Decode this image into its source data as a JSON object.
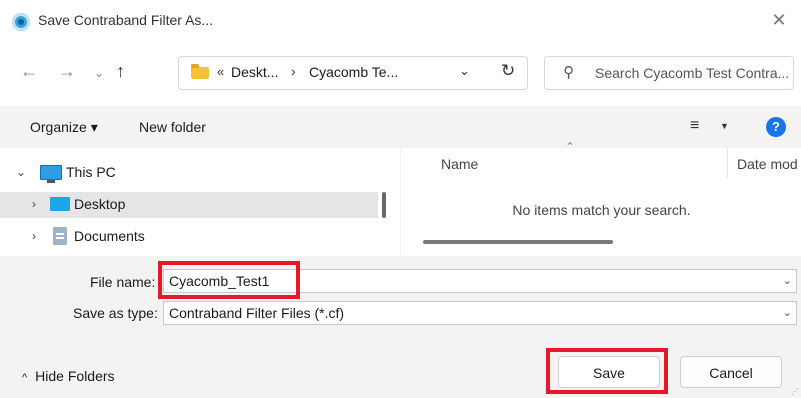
{
  "window": {
    "title": "Save Contraband Filter As...",
    "close_glyph": "✕"
  },
  "nav": {
    "back": "←",
    "forward": "→",
    "recent": "⌄",
    "up": "↑",
    "breadcrumb_chevron": "«",
    "breadcrumbs": [
      "Deskt...",
      "Cyacomb Te..."
    ],
    "breadcrumb_sep": "›",
    "address_dropdown": "⌄",
    "refresh": "↻",
    "search_placeholder": "Search Cyacomb Test Contra..."
  },
  "toolbar": {
    "organize": "Organize ▾",
    "new_folder": "New folder",
    "view_glyph": "≡",
    "view_dropdown": "▼",
    "help_glyph": "?"
  },
  "tree": {
    "items": [
      {
        "label": "This PC",
        "chevron": "⌄",
        "icon": "pc-icon"
      },
      {
        "label": "Desktop",
        "chevron": "›",
        "icon": "desktop-icon",
        "selected": true
      },
      {
        "label": "Documents",
        "chevron": "›",
        "icon": "documents-icon"
      }
    ]
  },
  "content": {
    "columns": [
      "Name",
      "Date mod"
    ],
    "sort_glyph": "⌃",
    "empty_message": "No items match your search."
  },
  "form": {
    "file_name_label": "File name:",
    "file_name_value": "Cyacomb_Test1",
    "save_type_label": "Save as type:",
    "save_type_value": "Contraband Filter Files (*.cf)",
    "dropdown_glyph": "⌄"
  },
  "footer": {
    "hide_folders": "Hide Folders",
    "hide_chevron": "^",
    "save": "Save",
    "cancel": "Cancel"
  },
  "colors": {
    "highlight": "#e5192a",
    "accent": "#1a73e8"
  }
}
